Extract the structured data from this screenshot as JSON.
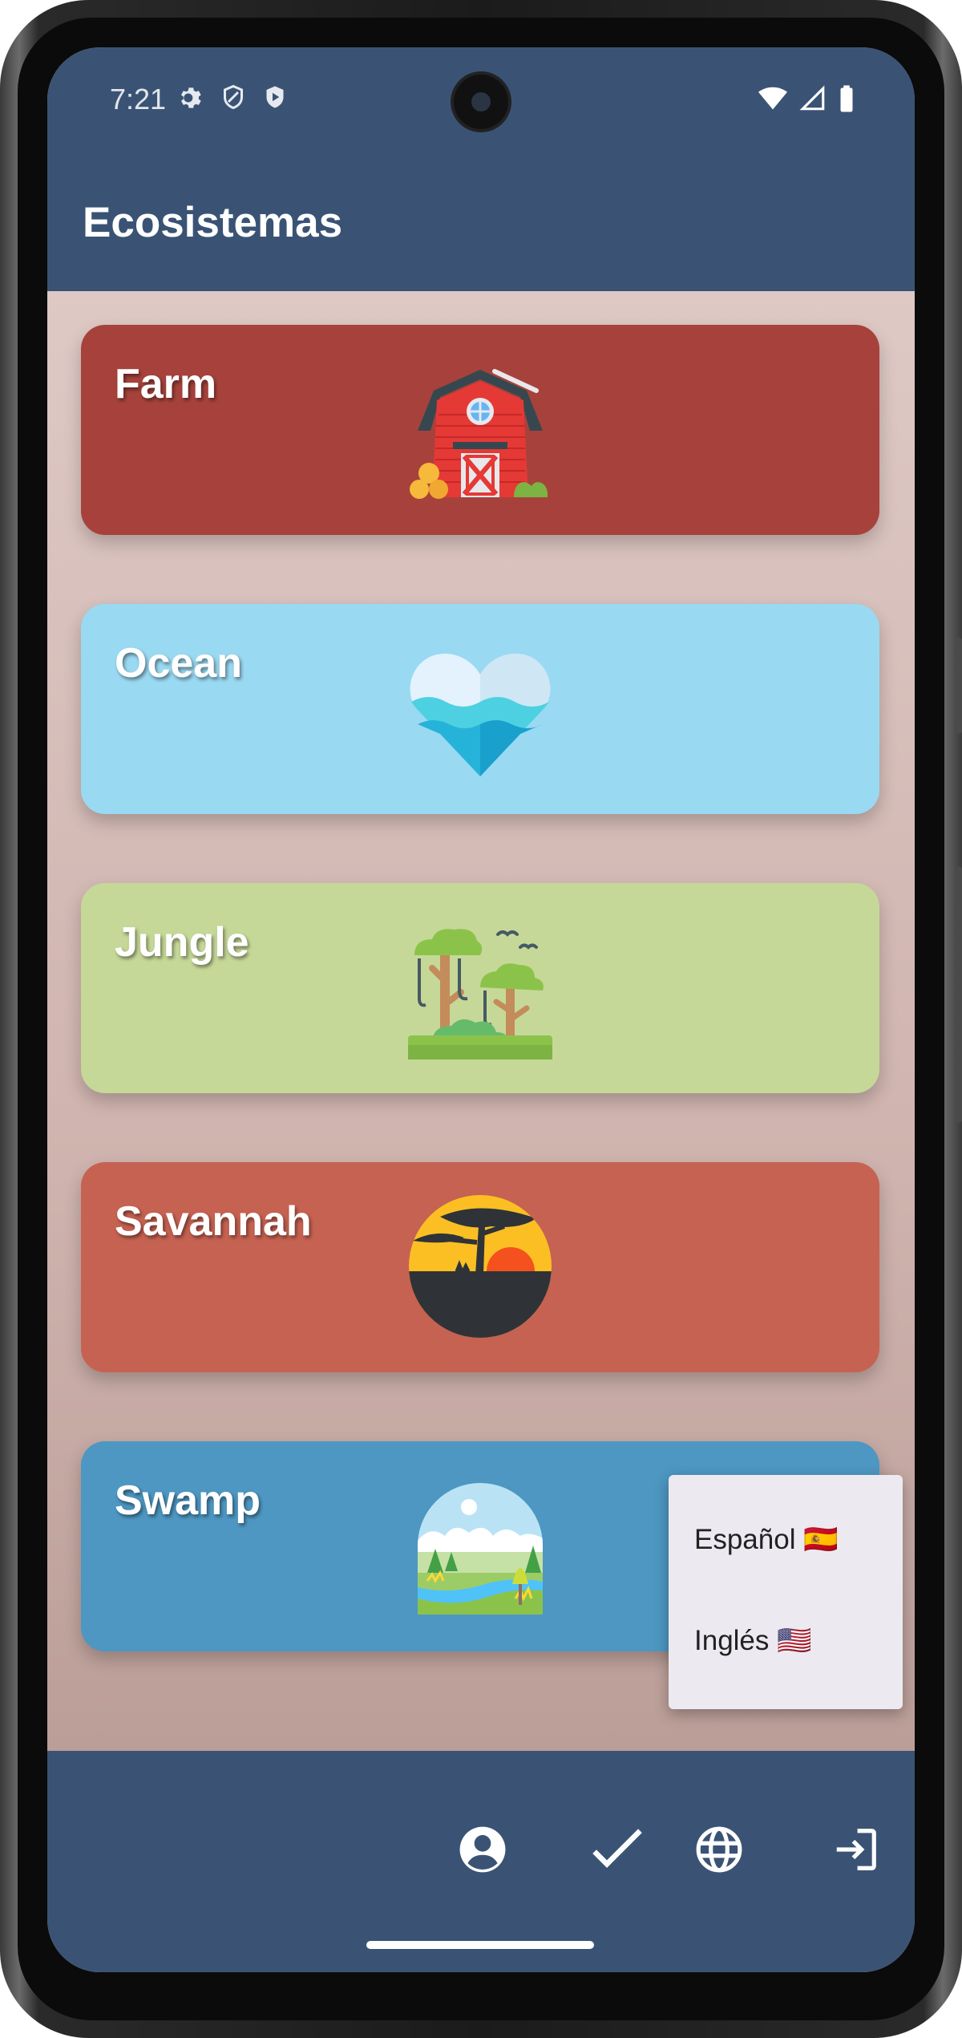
{
  "status_bar": {
    "time": "7:21"
  },
  "app_bar": {
    "title": "Ecosistemas"
  },
  "ecosystems": [
    {
      "label": "Farm",
      "color": "#a6423b",
      "icon": "barn-icon"
    },
    {
      "label": "Ocean",
      "color": "#9ad9f2",
      "icon": "ocean-heart-icon"
    },
    {
      "label": "Jungle",
      "color": "#c6d898",
      "icon": "jungle-trees-icon"
    },
    {
      "label": "Savannah",
      "color": "#c66252",
      "icon": "savannah-sunset-icon"
    },
    {
      "label": "Swamp",
      "color": "#4d97c2",
      "icon": "swamp-landscape-icon"
    }
  ],
  "language_menu": {
    "items": [
      {
        "label": "Español 🇪🇸"
      },
      {
        "label": "Inglés 🇺🇸"
      }
    ]
  },
  "bottom_nav": {
    "icons": [
      "account-circle-icon",
      "check-icon",
      "globe-icon",
      "logout-icon"
    ]
  },
  "colors": {
    "primary": "#3a5375",
    "background": "#cfb3ae"
  }
}
